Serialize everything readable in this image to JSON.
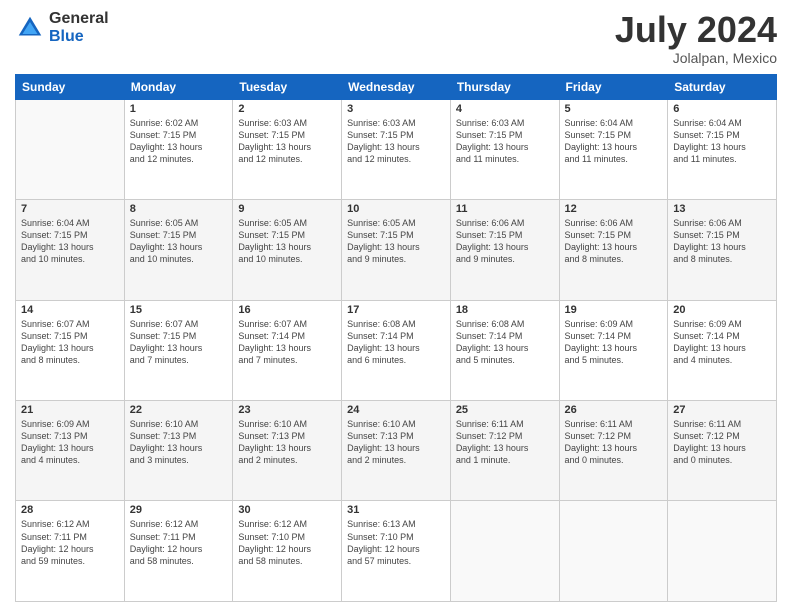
{
  "header": {
    "logo_general": "General",
    "logo_blue": "Blue",
    "month_title": "July 2024",
    "location": "Jolalpan, Mexico"
  },
  "weekdays": [
    "Sunday",
    "Monday",
    "Tuesday",
    "Wednesday",
    "Thursday",
    "Friday",
    "Saturday"
  ],
  "weeks": [
    [
      {
        "day": "",
        "info": ""
      },
      {
        "day": "1",
        "info": "Sunrise: 6:02 AM\nSunset: 7:15 PM\nDaylight: 13 hours\nand 12 minutes."
      },
      {
        "day": "2",
        "info": "Sunrise: 6:03 AM\nSunset: 7:15 PM\nDaylight: 13 hours\nand 12 minutes."
      },
      {
        "day": "3",
        "info": "Sunrise: 6:03 AM\nSunset: 7:15 PM\nDaylight: 13 hours\nand 12 minutes."
      },
      {
        "day": "4",
        "info": "Sunrise: 6:03 AM\nSunset: 7:15 PM\nDaylight: 13 hours\nand 11 minutes."
      },
      {
        "day": "5",
        "info": "Sunrise: 6:04 AM\nSunset: 7:15 PM\nDaylight: 13 hours\nand 11 minutes."
      },
      {
        "day": "6",
        "info": "Sunrise: 6:04 AM\nSunset: 7:15 PM\nDaylight: 13 hours\nand 11 minutes."
      }
    ],
    [
      {
        "day": "7",
        "info": "Sunrise: 6:04 AM\nSunset: 7:15 PM\nDaylight: 13 hours\nand 10 minutes."
      },
      {
        "day": "8",
        "info": "Sunrise: 6:05 AM\nSunset: 7:15 PM\nDaylight: 13 hours\nand 10 minutes."
      },
      {
        "day": "9",
        "info": "Sunrise: 6:05 AM\nSunset: 7:15 PM\nDaylight: 13 hours\nand 10 minutes."
      },
      {
        "day": "10",
        "info": "Sunrise: 6:05 AM\nSunset: 7:15 PM\nDaylight: 13 hours\nand 9 minutes."
      },
      {
        "day": "11",
        "info": "Sunrise: 6:06 AM\nSunset: 7:15 PM\nDaylight: 13 hours\nand 9 minutes."
      },
      {
        "day": "12",
        "info": "Sunrise: 6:06 AM\nSunset: 7:15 PM\nDaylight: 13 hours\nand 8 minutes."
      },
      {
        "day": "13",
        "info": "Sunrise: 6:06 AM\nSunset: 7:15 PM\nDaylight: 13 hours\nand 8 minutes."
      }
    ],
    [
      {
        "day": "14",
        "info": "Sunrise: 6:07 AM\nSunset: 7:15 PM\nDaylight: 13 hours\nand 8 minutes."
      },
      {
        "day": "15",
        "info": "Sunrise: 6:07 AM\nSunset: 7:15 PM\nDaylight: 13 hours\nand 7 minutes."
      },
      {
        "day": "16",
        "info": "Sunrise: 6:07 AM\nSunset: 7:14 PM\nDaylight: 13 hours\nand 7 minutes."
      },
      {
        "day": "17",
        "info": "Sunrise: 6:08 AM\nSunset: 7:14 PM\nDaylight: 13 hours\nand 6 minutes."
      },
      {
        "day": "18",
        "info": "Sunrise: 6:08 AM\nSunset: 7:14 PM\nDaylight: 13 hours\nand 5 minutes."
      },
      {
        "day": "19",
        "info": "Sunrise: 6:09 AM\nSunset: 7:14 PM\nDaylight: 13 hours\nand 5 minutes."
      },
      {
        "day": "20",
        "info": "Sunrise: 6:09 AM\nSunset: 7:14 PM\nDaylight: 13 hours\nand 4 minutes."
      }
    ],
    [
      {
        "day": "21",
        "info": "Sunrise: 6:09 AM\nSunset: 7:13 PM\nDaylight: 13 hours\nand 4 minutes."
      },
      {
        "day": "22",
        "info": "Sunrise: 6:10 AM\nSunset: 7:13 PM\nDaylight: 13 hours\nand 3 minutes."
      },
      {
        "day": "23",
        "info": "Sunrise: 6:10 AM\nSunset: 7:13 PM\nDaylight: 13 hours\nand 2 minutes."
      },
      {
        "day": "24",
        "info": "Sunrise: 6:10 AM\nSunset: 7:13 PM\nDaylight: 13 hours\nand 2 minutes."
      },
      {
        "day": "25",
        "info": "Sunrise: 6:11 AM\nSunset: 7:12 PM\nDaylight: 13 hours\nand 1 minute."
      },
      {
        "day": "26",
        "info": "Sunrise: 6:11 AM\nSunset: 7:12 PM\nDaylight: 13 hours\nand 0 minutes."
      },
      {
        "day": "27",
        "info": "Sunrise: 6:11 AM\nSunset: 7:12 PM\nDaylight: 13 hours\nand 0 minutes."
      }
    ],
    [
      {
        "day": "28",
        "info": "Sunrise: 6:12 AM\nSunset: 7:11 PM\nDaylight: 12 hours\nand 59 minutes."
      },
      {
        "day": "29",
        "info": "Sunrise: 6:12 AM\nSunset: 7:11 PM\nDaylight: 12 hours\nand 58 minutes."
      },
      {
        "day": "30",
        "info": "Sunrise: 6:12 AM\nSunset: 7:10 PM\nDaylight: 12 hours\nand 58 minutes."
      },
      {
        "day": "31",
        "info": "Sunrise: 6:13 AM\nSunset: 7:10 PM\nDaylight: 12 hours\nand 57 minutes."
      },
      {
        "day": "",
        "info": ""
      },
      {
        "day": "",
        "info": ""
      },
      {
        "day": "",
        "info": ""
      }
    ]
  ]
}
